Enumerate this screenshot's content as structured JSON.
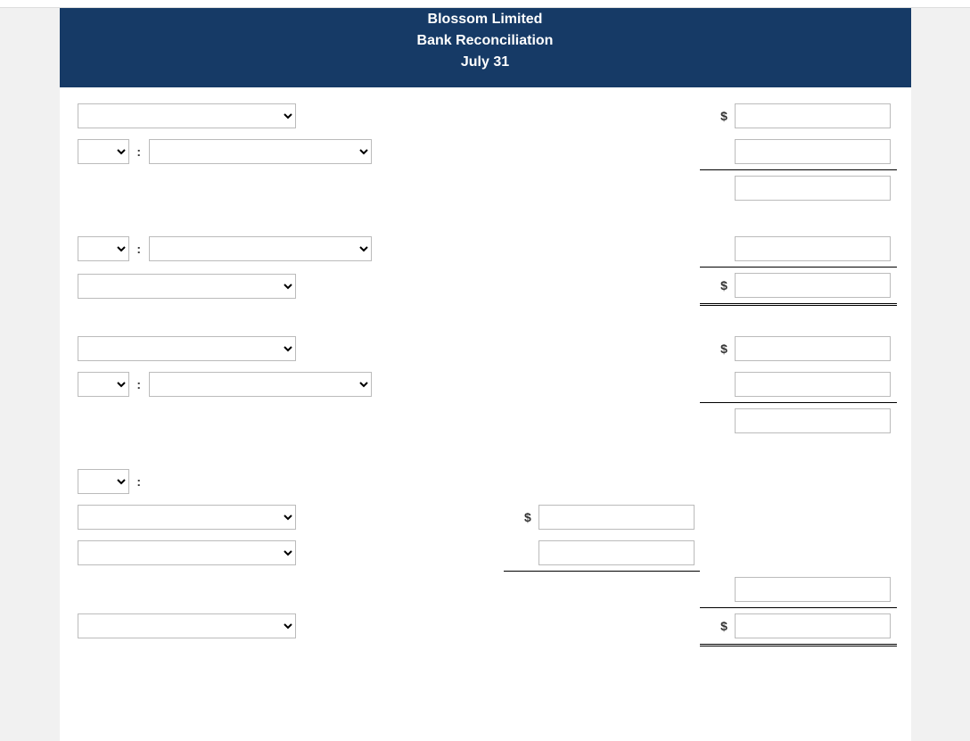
{
  "header": {
    "company": "Blossom Limited",
    "title": "Bank Reconciliation",
    "date": "July 31"
  },
  "symbols": {
    "dollar": "$",
    "colon": ":"
  },
  "rows": {
    "r1": {
      "sel_wide": "",
      "amt6": ""
    },
    "r2": {
      "keyword": "",
      "account": "",
      "amt6": ""
    },
    "r3": {
      "amt6": ""
    },
    "r4": {
      "keyword": "",
      "account": "",
      "amt6": ""
    },
    "r5": {
      "sel_wide": "",
      "amt6": ""
    },
    "r6": {
      "sel_wide": "",
      "amt6": ""
    },
    "r7": {
      "keyword": "",
      "account": "",
      "amt6": ""
    },
    "r8": {
      "amt6": ""
    },
    "r9": {
      "keyword": ""
    },
    "r10": {
      "sel_wide": "",
      "amt4": ""
    },
    "r11": {
      "sel_wide": "",
      "amt4": ""
    },
    "r12": {
      "amt6": ""
    },
    "r13": {
      "sel_wide": "",
      "amt6": ""
    }
  }
}
